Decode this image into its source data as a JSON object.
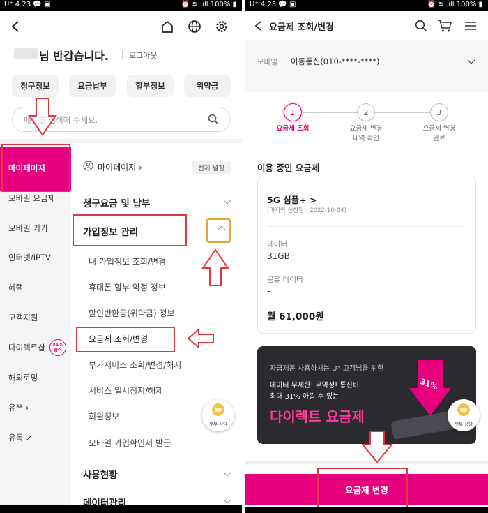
{
  "status": {
    "left": "U⁺ 4:23 💬 ▣",
    "right": "⏰ ≋ .ıll 100% ▮"
  },
  "left": {
    "greeting": "님 반갑습니다.",
    "logout": "로그아웃",
    "chips": [
      "청구정보",
      "요금납부",
      "할부정보",
      "위약금"
    ],
    "search_placeholder": "메뉴를 검색해 주세요.",
    "side_items": [
      "마이페이지",
      "모바일 요금제",
      "모바일 기기",
      "인터넷/IPTV",
      "혜택",
      "고객지원",
      "다이렉트샵",
      "해외로밍",
      "유쓰 ›",
      "유독 ↗"
    ],
    "direct_badge": "31%\n할인",
    "mypage_link": "마이페이지 ›",
    "expand_all": "전체 펼침",
    "sections": [
      "청구요금 및 납부",
      "가입정보 관리",
      "사용현황",
      "데이터관리"
    ],
    "subs": [
      "내 가입정보 조회/변경",
      "휴대폰 할부 약정 정보",
      "할인반환금(위약금) 정보",
      "요금제 조회/변경",
      "부가서비스 조회/변경/해지",
      "서비스 일시정지/해제",
      "회원정보",
      "모바일 가입확인서 발급"
    ],
    "chatbot": "챗봇 상담"
  },
  "right": {
    "title": "요금제 조회/변경",
    "mobile_label": "모바일",
    "line": "이동통신(010-****-****)",
    "steps": [
      {
        "num": "1",
        "label": "요금제 조회"
      },
      {
        "num": "2",
        "label": "요금제 변경\n내역 확인"
      },
      {
        "num": "3",
        "label": "요금제 변경\n완료"
      }
    ],
    "current_title": "이용 중인 요금제",
    "plan_name": "5G 심플+ >",
    "plan_date": "(마지막 신청일 : 2022-10-04)",
    "data_label": "데이터",
    "data_value": "31GB",
    "share_label": "공유 데이터",
    "share_value": "-",
    "price": "월 61,000원",
    "banner_line1": "자급제폰 사용하시는 U⁺ 고객님을 위한",
    "banner_line2": "데이터 무제한! 무약정! 통신비",
    "banner_line3": "최대 31% 아낄 수 있는",
    "banner_big": "다이렉트 요금제",
    "banner_badge": "31%",
    "chatbot": "챗봇 상담",
    "cta": "요금제 변경"
  },
  "colors": {
    "accent": "#e6007e",
    "highlight": "#e8343f",
    "banner_bg": "#2b2b2f"
  }
}
